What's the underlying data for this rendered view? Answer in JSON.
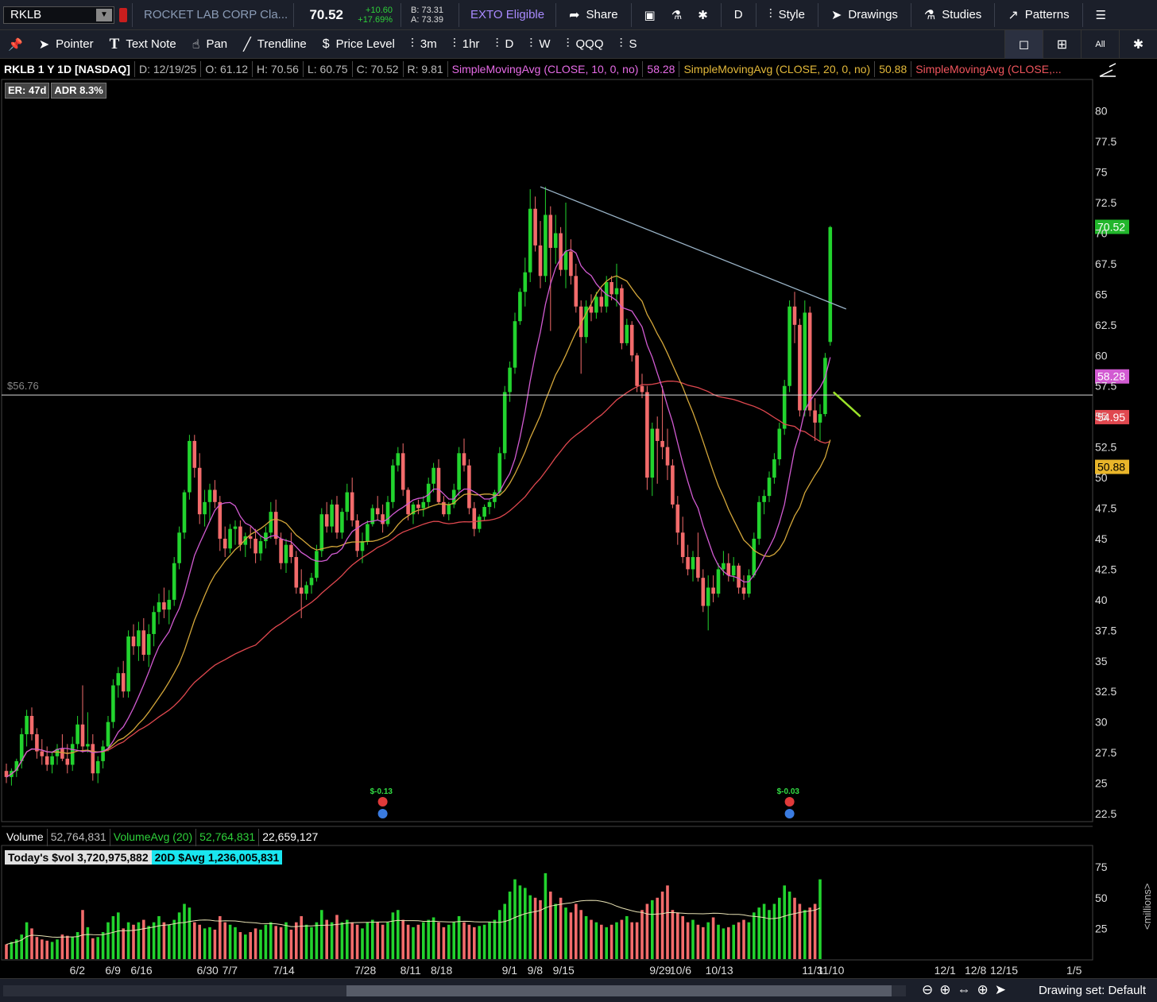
{
  "header": {
    "symbol": "RKLB",
    "company": "ROCKET LAB CORP Cla...",
    "last": "70.52",
    "change": "+10.60",
    "change_pct": "+17.69%",
    "bid": "B: 73.31",
    "ask": "A: 73.39",
    "exto": "EXTO Eligible",
    "share": "Share",
    "period": "D",
    "style": "Style",
    "drawings": "Drawings",
    "studies": "Studies",
    "patterns": "Patterns"
  },
  "toolbar": {
    "pointer": "Pointer",
    "text_note": "Text Note",
    "pan": "Pan",
    "trendline": "Trendline",
    "price_level": "Price Level",
    "tf_3m": "3m",
    "tf_1hr": "1hr",
    "tf_d": "D",
    "tf_w": "W",
    "tf_qqq": "QQQ",
    "tf_s": "S",
    "all": "All"
  },
  "study_bar": {
    "title": "RKLB 1 Y 1D [NASDAQ]",
    "date": "D: 12/19/25",
    "open": "O: 61.12",
    "high": "H: 70.56",
    "low": "L: 60.75",
    "close": "C: 70.52",
    "range": "R: 9.81",
    "sma10": "SimpleMovingAvg (CLOSE, 10, 0, no)",
    "sma10_val": "58.28",
    "sma20": "SimpleMovingAvg (CLOSE, 20, 0, no)",
    "sma20_val": "50.88",
    "sma50": "SimpleMovingAvg (CLOSE,..."
  },
  "badges": {
    "er": "ER: 47d",
    "adr": "ADR 8.3%"
  },
  "price_level_label": "$56.76",
  "price_badges": {
    "last": "70.52",
    "sma10": "58.28",
    "sma50": "54.95",
    "sma20": "50.88"
  },
  "earnings": {
    "e1": "$-0.13",
    "e2": "$-0.03"
  },
  "volume_header": {
    "label": "Volume",
    "value": "52,764,831",
    "avg_label": "VolumeAvg (20)",
    "avg_value": "52,764,831",
    "other": "22,659,127"
  },
  "volume_sub": {
    "today": "Today's $vol 3,720,975,882",
    "avg20": "20D $Avg 1,236,005,831"
  },
  "status": {
    "drawing_set": "Drawing set: Default"
  },
  "volume_unit": "<millions>",
  "colors": {
    "up": "#22d32e",
    "down": "#f26b6b",
    "sma10": "#d25bd2",
    "sma20": "#d4a73a",
    "sma50": "#e0484f",
    "trend": "#9ab4c8"
  },
  "chart_data": {
    "type": "candlestick",
    "ylim": [
      22.5,
      80.5
    ],
    "y_ticks": [
      "80",
      "77.5",
      "75",
      "72.5",
      "70",
      "67.5",
      "65",
      "62.5",
      "60",
      "57.5",
      "55",
      "52.5",
      "50",
      "47.5",
      "45",
      "42.5",
      "40",
      "37.5",
      "35",
      "32.5",
      "30",
      "27.5",
      "25",
      "22.5"
    ],
    "x_ticks": [
      "6/2",
      "6/9",
      "6/16",
      "6/30",
      "7/7",
      "7/14",
      "7/28",
      "8/11",
      "8/18",
      "9/1",
      "9/8",
      "9/15",
      "9/29",
      "10/6",
      "10/13",
      "11/3",
      "11/10",
      "12/1",
      "12/8",
      "12/15",
      "1/5"
    ],
    "candles": [
      [
        26.0,
        26.6,
        25.0,
        25.5
      ],
      [
        25.5,
        26.2,
        24.8,
        26.0
      ],
      [
        26.0,
        27.0,
        25.5,
        26.8
      ],
      [
        26.8,
        29.5,
        26.2,
        29.0
      ],
      [
        29.0,
        31.0,
        28.0,
        30.5
      ],
      [
        30.5,
        31.2,
        28.5,
        29.0
      ],
      [
        29.0,
        29.5,
        27.0,
        27.6
      ],
      [
        27.6,
        28.6,
        26.5,
        27.2
      ],
      [
        27.2,
        28.0,
        26.0,
        26.5
      ],
      [
        26.5,
        27.6,
        25.8,
        27.2
      ],
      [
        27.2,
        28.2,
        26.5,
        27.8
      ],
      [
        27.8,
        29.0,
        26.8,
        27.0
      ],
      [
        27.0,
        28.2,
        25.8,
        26.5
      ],
      [
        26.5,
        28.8,
        26.0,
        28.2
      ],
      [
        28.2,
        30.5,
        27.8,
        29.8
      ],
      [
        29.8,
        33.0,
        27.5,
        28.0
      ],
      [
        28.0,
        30.8,
        27.5,
        28.2
      ],
      [
        28.2,
        29.0,
        25.2,
        25.8
      ],
      [
        25.8,
        27.2,
        25.0,
        26.8
      ],
      [
        26.8,
        28.5,
        26.2,
        28.0
      ],
      [
        28.0,
        30.5,
        27.6,
        30.0
      ],
      [
        30.0,
        33.5,
        29.5,
        33.0
      ],
      [
        33.0,
        34.5,
        32.0,
        34.0
      ],
      [
        34.0,
        35.0,
        32.0,
        32.5
      ],
      [
        32.5,
        37.5,
        32.0,
        37.0
      ],
      [
        37.0,
        38.0,
        35.5,
        36.2
      ],
      [
        36.2,
        38.2,
        35.0,
        37.5
      ],
      [
        37.5,
        38.5,
        35.0,
        35.5
      ],
      [
        35.5,
        38.0,
        34.5,
        37.2
      ],
      [
        37.2,
        39.5,
        36.2,
        39.0
      ],
      [
        39.0,
        40.5,
        38.0,
        39.8
      ],
      [
        39.8,
        41.0,
        38.5,
        39.2
      ],
      [
        39.2,
        40.8,
        38.0,
        40.0
      ],
      [
        40.0,
        43.5,
        39.5,
        43.0
      ],
      [
        43.0,
        46.0,
        42.5,
        45.5
      ],
      [
        45.5,
        49.0,
        45.0,
        48.8
      ],
      [
        48.8,
        53.5,
        48.2,
        53.0
      ],
      [
        53.0,
        53.5,
        50.0,
        50.8
      ],
      [
        50.8,
        52.0,
        46.2,
        47.0
      ],
      [
        47.0,
        49.0,
        46.0,
        48.0
      ],
      [
        48.0,
        49.5,
        46.5,
        49.0
      ],
      [
        49.0,
        49.8,
        47.5,
        48.0
      ],
      [
        48.0,
        48.5,
        44.0,
        45.0
      ],
      [
        45.0,
        46.0,
        43.5,
        44.2
      ],
      [
        44.2,
        46.2,
        43.8,
        45.8
      ],
      [
        45.8,
        46.5,
        44.5,
        46.0
      ],
      [
        46.0,
        46.5,
        44.0,
        44.5
      ],
      [
        44.5,
        45.5,
        43.5,
        45.2
      ],
      [
        45.2,
        46.0,
        44.2,
        45.0
      ],
      [
        45.0,
        45.8,
        43.0,
        43.8
      ],
      [
        43.8,
        45.2,
        43.2,
        44.8
      ],
      [
        44.8,
        46.0,
        44.2,
        45.5
      ],
      [
        45.5,
        48.0,
        45.0,
        47.2
      ],
      [
        47.2,
        48.2,
        44.5,
        45.0
      ],
      [
        45.0,
        45.5,
        42.5,
        43.0
      ],
      [
        43.0,
        45.0,
        42.2,
        44.5
      ],
      [
        44.5,
        45.5,
        43.0,
        43.5
      ],
      [
        43.5,
        44.0,
        40.5,
        41.0
      ],
      [
        41.0,
        42.5,
        38.5,
        40.5
      ],
      [
        40.5,
        41.5,
        40.0,
        41.2
      ],
      [
        41.2,
        42.2,
        40.5,
        41.8
      ],
      [
        41.8,
        44.5,
        41.5,
        44.0
      ],
      [
        44.0,
        47.5,
        43.5,
        47.0
      ],
      [
        47.0,
        48.0,
        45.5,
        46.0
      ],
      [
        46.0,
        48.2,
        45.5,
        47.8
      ],
      [
        47.8,
        48.5,
        45.0,
        45.5
      ],
      [
        45.5,
        47.5,
        45.0,
        47.2
      ],
      [
        47.2,
        49.5,
        46.5,
        48.8
      ],
      [
        48.8,
        50.0,
        46.0,
        46.5
      ],
      [
        46.5,
        47.0,
        43.5,
        44.0
      ],
      [
        44.0,
        45.5,
        43.0,
        44.8
      ],
      [
        44.8,
        46.5,
        44.5,
        46.2
      ],
      [
        46.2,
        47.8,
        46.0,
        47.5
      ],
      [
        47.5,
        48.5,
        46.5,
        47.0
      ],
      [
        47.0,
        47.8,
        45.5,
        46.2
      ],
      [
        46.2,
        48.5,
        46.0,
        48.0
      ],
      [
        48.0,
        51.5,
        47.5,
        51.0
      ],
      [
        51.0,
        52.5,
        50.5,
        52.0
      ],
      [
        52.0,
        52.8,
        48.5,
        49.0
      ],
      [
        49.0,
        49.2,
        46.5,
        47.0
      ],
      [
        47.0,
        48.0,
        46.2,
        47.8
      ],
      [
        47.8,
        48.2,
        47.0,
        47.5
      ],
      [
        47.5,
        48.5,
        46.8,
        48.0
      ],
      [
        48.0,
        50.0,
        47.5,
        49.5
      ],
      [
        49.5,
        51.2,
        48.8,
        50.8
      ],
      [
        50.8,
        51.5,
        47.8,
        48.0
      ],
      [
        48.0,
        48.5,
        46.8,
        47.0
      ],
      [
        47.0,
        48.0,
        46.5,
        47.8
      ],
      [
        47.8,
        49.5,
        47.5,
        49.0
      ],
      [
        49.0,
        52.5,
        48.5,
        52.0
      ],
      [
        52.0,
        53.2,
        50.5,
        51.0
      ],
      [
        51.0,
        51.5,
        47.0,
        47.5
      ],
      [
        47.5,
        48.0,
        45.2,
        45.8
      ],
      [
        45.8,
        47.0,
        45.5,
        46.8
      ],
      [
        46.8,
        47.8,
        46.5,
        47.6
      ],
      [
        47.6,
        48.2,
        47.0,
        48.0
      ],
      [
        48.0,
        49.0,
        47.5,
        48.8
      ],
      [
        48.8,
        52.5,
        48.5,
        52.0
      ],
      [
        52.0,
        57.5,
        51.5,
        57.0
      ],
      [
        57.0,
        59.5,
        56.2,
        59.0
      ],
      [
        59.0,
        63.5,
        58.5,
        62.8
      ],
      [
        62.8,
        65.5,
        62.5,
        65.2
      ],
      [
        65.2,
        68.0,
        64.0,
        66.8
      ],
      [
        66.8,
        73.6,
        66.0,
        72.0
      ],
      [
        72.0,
        73.0,
        68.5,
        69.0
      ],
      [
        69.0,
        71.0,
        65.5,
        66.5
      ],
      [
        66.5,
        73.8,
        66.0,
        71.5
      ],
      [
        71.5,
        72.2,
        62.0,
        68.8
      ],
      [
        68.8,
        71.5,
        67.5,
        70.0
      ],
      [
        70.0,
        70.5,
        66.5,
        67.0
      ],
      [
        67.0,
        72.5,
        65.5,
        68.5
      ],
      [
        68.5,
        69.5,
        65.8,
        66.5
      ],
      [
        66.5,
        67.5,
        63.5,
        64.0
      ],
      [
        64.0,
        64.5,
        58.5,
        61.5
      ],
      [
        61.5,
        64.5,
        61.0,
        64.0
      ],
      [
        64.0,
        65.0,
        62.8,
        63.5
      ],
      [
        63.5,
        65.2,
        63.0,
        64.8
      ],
      [
        64.8,
        65.5,
        63.5,
        64.0
      ],
      [
        64.0,
        66.5,
        63.5,
        66.0
      ],
      [
        66.0,
        66.5,
        64.5,
        65.0
      ],
      [
        65.0,
        67.5,
        64.0,
        65.5
      ],
      [
        65.5,
        65.8,
        60.5,
        61.0
      ],
      [
        61.0,
        63.0,
        60.8,
        62.5
      ],
      [
        62.5,
        62.8,
        59.5,
        60.0
      ],
      [
        60.0,
        60.2,
        57.0,
        57.5
      ],
      [
        57.5,
        58.5,
        56.5,
        57.0
      ],
      [
        57.0,
        57.5,
        49.0,
        50.0
      ],
      [
        50.0,
        54.5,
        48.5,
        54.0
      ],
      [
        54.0,
        55.0,
        49.5,
        53.0
      ],
      [
        53.0,
        57.5,
        51.5,
        52.5
      ],
      [
        52.5,
        54.0,
        49.8,
        51.0
      ],
      [
        51.0,
        51.5,
        47.5,
        47.8
      ],
      [
        47.8,
        48.5,
        44.5,
        45.5
      ],
      [
        45.5,
        46.8,
        43.0,
        43.5
      ],
      [
        43.5,
        44.5,
        42.0,
        42.5
      ],
      [
        42.5,
        44.0,
        41.5,
        43.5
      ],
      [
        43.5,
        45.5,
        41.5,
        41.8
      ],
      [
        41.8,
        42.5,
        39.0,
        39.5
      ],
      [
        39.5,
        42.0,
        37.5,
        41.0
      ],
      [
        41.0,
        42.0,
        39.8,
        40.5
      ],
      [
        40.5,
        43.0,
        40.2,
        42.5
      ],
      [
        42.5,
        44.0,
        42.0,
        43.0
      ],
      [
        43.0,
        43.8,
        41.5,
        42.0
      ],
      [
        42.0,
        43.5,
        41.5,
        42.8
      ],
      [
        42.8,
        43.0,
        40.5,
        41.0
      ],
      [
        41.0,
        42.0,
        40.0,
        40.5
      ],
      [
        40.5,
        42.5,
        40.2,
        42.0
      ],
      [
        42.0,
        45.5,
        41.8,
        45.0
      ],
      [
        45.0,
        48.5,
        44.5,
        48.0
      ],
      [
        48.0,
        49.0,
        47.0,
        48.5
      ],
      [
        48.5,
        50.5,
        48.0,
        50.0
      ],
      [
        50.0,
        52.0,
        49.5,
        51.5
      ],
      [
        51.5,
        54.5,
        51.0,
        54.0
      ],
      [
        54.0,
        58.0,
        53.5,
        57.5
      ],
      [
        57.5,
        64.5,
        57.0,
        64.0
      ],
      [
        64.0,
        65.2,
        61.0,
        62.5
      ],
      [
        62.5,
        63.0,
        55.0,
        55.5
      ],
      [
        55.5,
        64.5,
        55.0,
        63.5
      ],
      [
        63.5,
        64.0,
        55.0,
        55.5
      ],
      [
        55.5,
        56.5,
        53.0,
        54.5
      ],
      [
        54.5,
        56.0,
        53.0,
        55.2
      ],
      [
        55.2,
        60.2,
        55.0,
        59.8
      ],
      [
        61.1,
        70.6,
        60.8,
        70.5
      ]
    ],
    "volume": [
      12,
      14,
      16,
      20,
      30,
      25,
      18,
      16,
      15,
      14,
      16,
      20,
      19,
      18,
      22,
      40,
      26,
      17,
      18,
      22,
      30,
      35,
      38,
      25,
      30,
      28,
      30,
      32,
      27,
      30,
      35,
      30,
      28,
      32,
      38,
      45,
      42,
      30,
      28,
      25,
      26,
      24,
      35,
      30,
      28,
      26,
      22,
      20,
      22,
      25,
      24,
      28,
      30,
      27,
      26,
      30,
      24,
      30,
      35,
      28,
      26,
      30,
      40,
      32,
      30,
      36,
      30,
      32,
      30,
      28,
      25,
      30,
      32,
      30,
      28,
      30,
      38,
      40,
      32,
      28,
      26,
      28,
      30,
      32,
      34,
      30,
      26,
      28,
      30,
      35,
      30,
      28,
      26,
      27,
      28,
      30,
      32,
      40,
      45,
      55,
      65,
      60,
      58,
      52,
      50,
      48,
      70,
      55,
      45,
      50,
      42,
      38,
      45,
      40,
      35,
      32,
      30,
      28,
      26,
      28,
      30,
      32,
      35,
      30,
      30,
      40,
      45,
      48,
      50,
      55,
      60,
      40,
      38,
      35,
      30,
      32,
      28,
      26,
      30,
      34,
      28,
      25,
      26,
      28,
      30,
      32,
      30,
      38,
      42,
      45,
      40,
      45,
      50,
      60,
      55,
      50,
      45,
      40,
      42,
      45,
      65
    ]
  }
}
